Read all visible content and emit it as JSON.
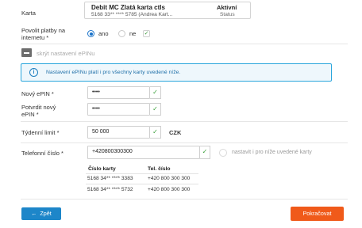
{
  "card": {
    "label": "Karta",
    "name": "Debit MC Zlatá karta ctls",
    "number": "5168 33** **** 5785 (Andrea Kart...",
    "status_value": "Aktivní",
    "status_label": "Status"
  },
  "internet": {
    "label_line1": "Povolit platby na",
    "label_line2": "internetu *",
    "option_yes": "ano",
    "option_no": "ne",
    "selected": "ano",
    "confirm_icon": "check-icon"
  },
  "epin_toggle": {
    "label": "skrýt nastavení ePINu",
    "icon": "minus-icon"
  },
  "info": {
    "icon": "info-icon",
    "text": "Nastavení ePINu platí i pro všechny karty uvedené níže."
  },
  "new_epin": {
    "label": "Nový ePIN *",
    "value": "••••"
  },
  "confirm_epin": {
    "label_line1": "Potvrdit nový",
    "label_line2": "ePIN *",
    "value": "••••"
  },
  "weekly_limit": {
    "label": "Týdenní limit *",
    "value": "50 000",
    "currency": "CZK"
  },
  "phone": {
    "label": "Telefonní číslo *",
    "value": "+420800300300",
    "apply_all_label": "nastavit i pro níže uvedené karty"
  },
  "cards_table": {
    "headers": [
      "Číslo karty",
      "Tel. číslo"
    ],
    "rows": [
      [
        "5168 34** **** 3383",
        "+420 800 300 300"
      ],
      [
        "5168 34** **** 5732",
        "+420 800 300 300"
      ]
    ]
  },
  "buttons": {
    "back_label": "Zpět",
    "back_arrow": "←",
    "next_label": "Pokračovat"
  },
  "colors": {
    "primary_blue": "#1d86c9",
    "accent_orange": "#f05a1a",
    "valid_green": "#3aa03a",
    "info_border": "#2aa6dc"
  }
}
